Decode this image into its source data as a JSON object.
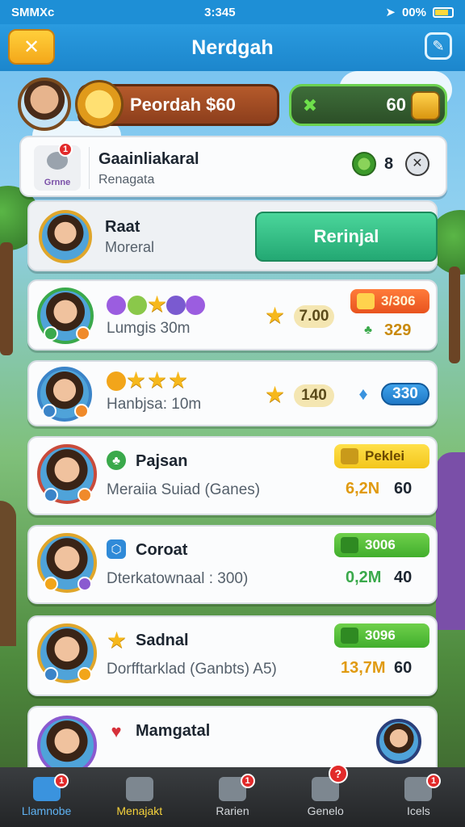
{
  "status_bar": {
    "carrier": "SMMXc",
    "time": "3:345",
    "battery": "00%"
  },
  "header": {
    "title": "Nerdgah",
    "back_label": "✕"
  },
  "resources": {
    "coins_label": "Peordah $60",
    "gems_value": "60"
  },
  "header_card": {
    "title": "Gaainliakaral",
    "subtitle": "Renagata",
    "icon_label": "Grnne",
    "count": "8",
    "badge": "1"
  },
  "featured": {
    "name": "Raat",
    "subtitle": "Moreral",
    "button_label": "Rerinjal"
  },
  "rows": [
    {
      "name": "",
      "subtitle": "Lumgis 30m",
      "star_value": "7.00",
      "tag_label": "3/306",
      "secondary_value": "329"
    },
    {
      "name": "",
      "subtitle": "Hanbjsa: 10m",
      "star_value": "140",
      "secondary_value": "330"
    },
    {
      "name": "Pajsan",
      "subtitle": "Meraiia Suiad (Ganes)",
      "tag_label": "Peklei",
      "value_a": "6,2N",
      "value_b": "60"
    },
    {
      "name": "Coroat",
      "subtitle": "Dterkatownaal : 300)",
      "tag_label": "3006",
      "value_a": "0,2M",
      "value_b": "40"
    },
    {
      "name": "Sadnal",
      "subtitle": "Dorfftarklad (Ganbts) A5)",
      "tag_label": "3096",
      "value_a": "13,7M",
      "value_b": "60"
    },
    {
      "name": "Mamgatal",
      "subtitle": ""
    }
  ],
  "bottom_nav": [
    {
      "label": "Llamnobe",
      "badge": "1"
    },
    {
      "label": "Menajakt"
    },
    {
      "label": "Rarien",
      "badge": "1"
    },
    {
      "label": "Genelo",
      "badge": "?"
    },
    {
      "label": "Icels",
      "badge": "1"
    }
  ],
  "colors": {
    "primary": "#1e8fd6",
    "accent_green": "#23a873",
    "gold": "#f6b81c"
  }
}
